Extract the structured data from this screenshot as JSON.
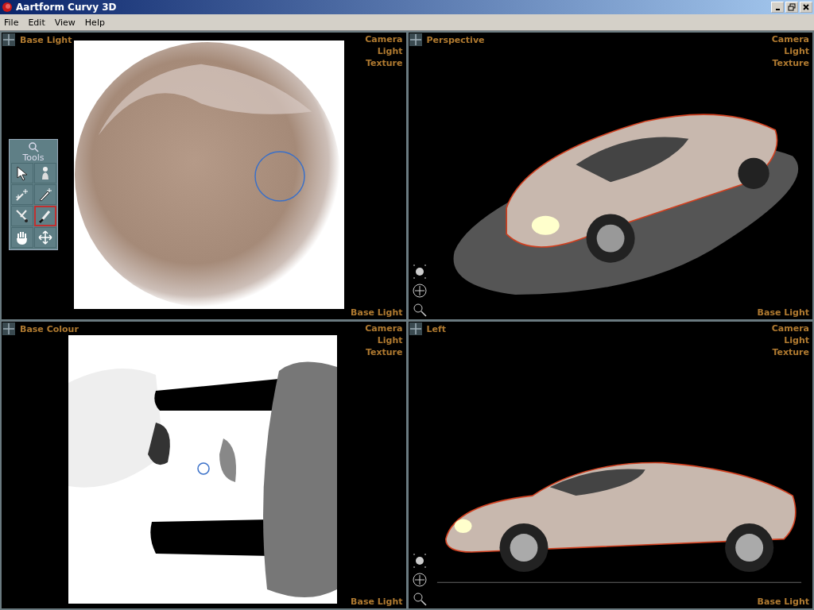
{
  "window": {
    "title": "Aartform Curvy 3D"
  },
  "menu": [
    "File",
    "Edit",
    "View",
    "Help"
  ],
  "viewports": [
    {
      "title": "Base Light",
      "kind": "paint",
      "menu": [
        "Camera",
        "Light",
        "Texture"
      ],
      "footer": "Base Light"
    },
    {
      "title": "Perspective",
      "kind": "perspective",
      "menu": [
        "Camera",
        "Light",
        "Texture"
      ],
      "footer": "Base Light"
    },
    {
      "title": "Base Colour",
      "kind": "uv",
      "menu": [
        "Camera",
        "Light",
        "Texture"
      ],
      "footer": "Base Light"
    },
    {
      "title": "Left",
      "kind": "side",
      "menu": [
        "Camera",
        "Light",
        "Texture"
      ],
      "footer": "Base Light"
    }
  ],
  "tools": {
    "title": "Tools",
    "items": [
      {
        "kind": "select",
        "selected": false
      },
      {
        "kind": "pawn",
        "selected": false
      },
      {
        "kind": "add",
        "selected": false
      },
      {
        "kind": "pen",
        "selected": false
      },
      {
        "kind": "cut",
        "selected": false
      },
      {
        "kind": "brush",
        "selected": true
      },
      {
        "kind": "hand",
        "selected": false
      },
      {
        "kind": "move",
        "selected": false
      }
    ]
  }
}
